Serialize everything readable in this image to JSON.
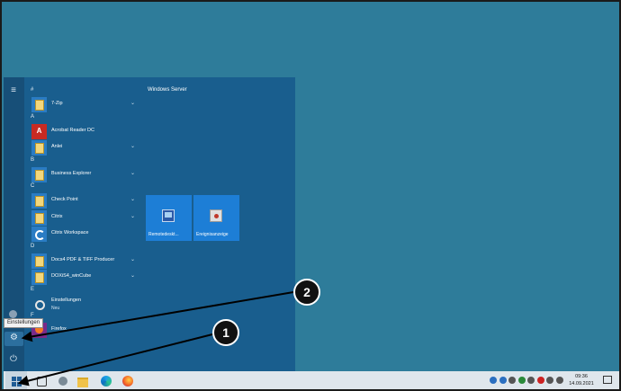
{
  "start_menu": {
    "group_title": "Windows Server",
    "tooltip": "Einstellungen",
    "rail_icons": [
      "hamburger-icon",
      "avatar-icon",
      "gear-icon",
      "power-icon"
    ],
    "sections": [
      {
        "letter": "#",
        "apps": [
          {
            "label": "7-Zip",
            "icon": "folder-icon",
            "expandable": true
          }
        ]
      },
      {
        "letter": "A",
        "apps": [
          {
            "label": "Acrobat Reader DC",
            "icon": "acrobat-icon",
            "expandable": false
          },
          {
            "label": "Anlei",
            "icon": "folder-icon",
            "expandable": true
          }
        ]
      },
      {
        "letter": "B",
        "apps": [
          {
            "label": "Business Explorer",
            "icon": "folder-icon",
            "expandable": true
          }
        ]
      },
      {
        "letter": "C",
        "apps": [
          {
            "label": "Check Point",
            "icon": "folder-icon",
            "expandable": true
          },
          {
            "label": "Citrix",
            "icon": "folder-icon",
            "expandable": true
          },
          {
            "label": "Citrix Workspace",
            "icon": "citrix-icon",
            "expandable": false
          }
        ]
      },
      {
        "letter": "D",
        "apps": [
          {
            "label": "Docs4 PDF & TIFF Producer",
            "icon": "folder-icon",
            "expandable": true
          },
          {
            "label": "DOXiS4_winCube",
            "icon": "folder-icon",
            "expandable": true
          }
        ]
      },
      {
        "letter": "E",
        "apps": [
          {
            "label": "Einstellungen",
            "sub": "Neu",
            "icon": "settings-icon",
            "expandable": false
          }
        ]
      },
      {
        "letter": "F",
        "apps": [
          {
            "label": "Firefox",
            "icon": "firefox-icon",
            "expandable": false
          }
        ]
      }
    ],
    "tiles": [
      {
        "label": "Remotedeskt...",
        "icon": "remote-desktop-icon"
      },
      {
        "label": "Ereignisanzeige",
        "icon": "event-viewer-icon"
      }
    ]
  },
  "taskbar": {
    "clock_time": "09:36",
    "clock_date": "14.09.2021",
    "pinned": [
      "search-icon",
      "task-view-icon",
      "file-explorer-icon",
      "edge-icon",
      "firefox-icon"
    ],
    "tray_colors": [
      "#2b6fc0",
      "#2b6fc0",
      "#555555",
      "#2a8a3a",
      "#555555",
      "#cc2222",
      "#555555",
      "#555555"
    ]
  },
  "callouts": [
    "2",
    "1"
  ]
}
